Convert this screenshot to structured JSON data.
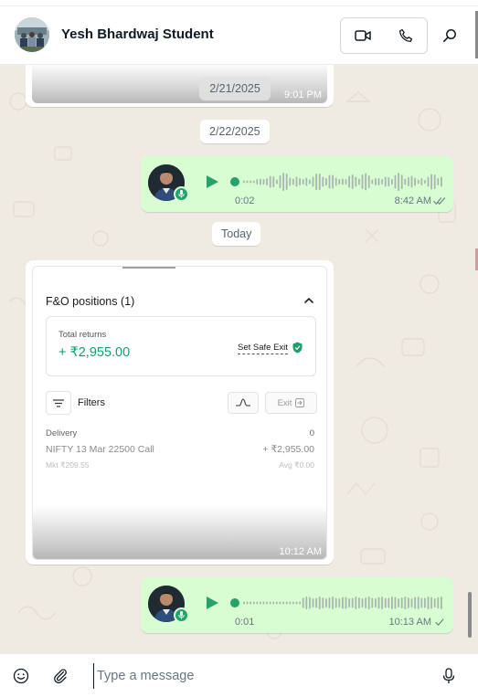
{
  "header": {
    "contact_name": "Yesh Bhardwaj Student",
    "icons": [
      "video-call-icon",
      "voice-call-icon",
      "search-icon"
    ]
  },
  "chat": {
    "first_media": {
      "date_overlay": "2/21/2025",
      "time": "9:01 PM"
    },
    "date_divider_1": "2/22/2025",
    "voice_1": {
      "duration": "0:02",
      "time": "8:42 AM",
      "status": "read",
      "progress": 0
    },
    "date_divider_2": "Today",
    "screenshot_card": {
      "title": "F&O positions (1)",
      "total_returns_label": "Total returns",
      "total_returns_value": "+ ₹2,955.00",
      "safe_exit_label": "Set Safe Exit",
      "filters_label": "Filters",
      "exit_label": "Exit",
      "section_label": "Delivery",
      "section_count": "0",
      "position_name": "NIFTY 13 Mar 22500 Call",
      "position_pnl": "+ ₹2,955.00",
      "position_mkt": "Mkt ₹209.55",
      "position_avg": "Avg ₹0.00",
      "time": "10:12 AM"
    },
    "voice_2": {
      "duration": "0:01",
      "time": "10:13 AM",
      "status": "sent",
      "progress": 0
    }
  },
  "footer": {
    "input_placeholder": "Type a message",
    "icons": [
      "emoji-icon",
      "attach-icon",
      "mic-icon"
    ]
  },
  "colors": {
    "chat_background": "#efeae2",
    "outgoing_bubble": "#d9fdd3",
    "accent_green": "#25a36b",
    "returns_green": "#0e9f6e",
    "read_tick_blue": "#53bdeb"
  }
}
